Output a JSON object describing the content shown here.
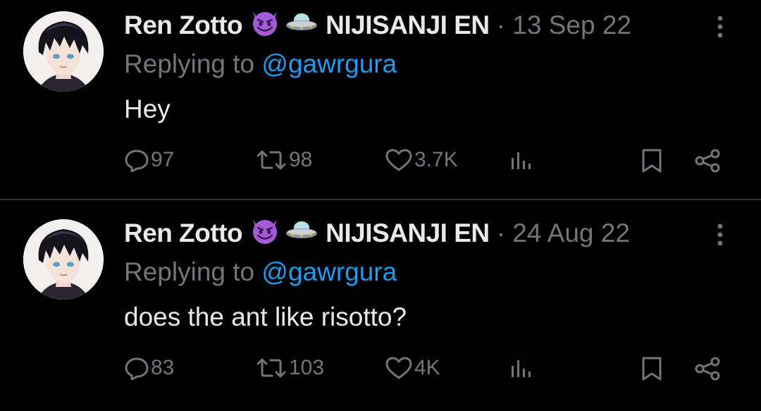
{
  "tweets": [
    {
      "author": "Ren Zotto",
      "affiliation": "NIJISANJI EN",
      "separator": "·",
      "date": "13 Sep 22",
      "reply_prefix": "Replying to",
      "reply_handle": "@gawrgura",
      "text": "Hey",
      "replies": "97",
      "retweets": "98",
      "likes": "3.7K"
    },
    {
      "author": "Ren Zotto",
      "affiliation": "NIJISANJI EN",
      "separator": "·",
      "date": "24 Aug 22",
      "reply_prefix": "Replying to",
      "reply_handle": "@gawrgura",
      "text": "does the ant like risotto?",
      "replies": "83",
      "retweets": "103",
      "likes": "4K"
    }
  ],
  "icons": [
    "avatar",
    "smiling-devil-emoji",
    "ufo-emoji",
    "more-icon",
    "reply-icon",
    "retweet-icon",
    "like-icon",
    "views-icon",
    "bookmark-icon",
    "share-icon"
  ],
  "colors": {
    "background": "#000000",
    "text": "#e7e9ea",
    "muted": "#71767b",
    "link": "#1d9bf0",
    "divider": "#2f3336",
    "devil": "#a35bd6"
  }
}
